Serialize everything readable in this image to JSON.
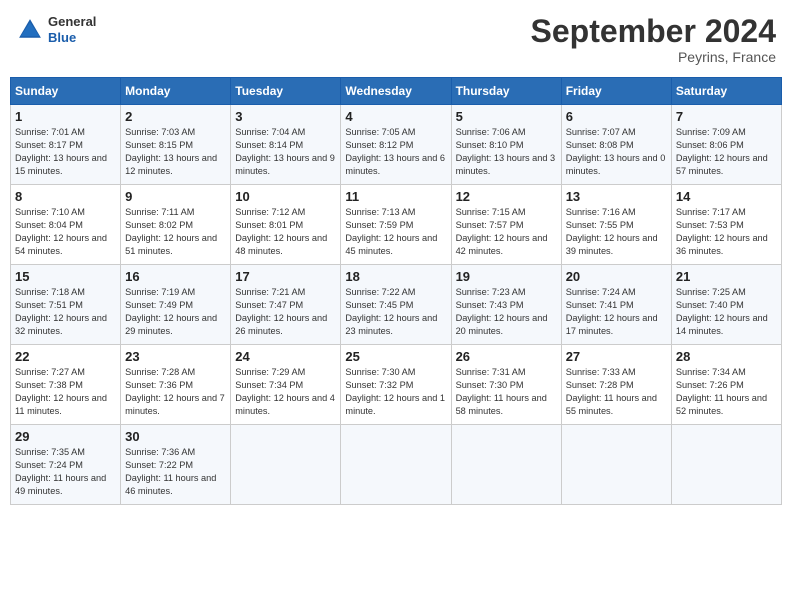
{
  "header": {
    "logo": {
      "line1": "General",
      "line2": "Blue"
    },
    "title": "September 2024",
    "subtitle": "Peyrins, France"
  },
  "days_of_week": [
    "Sunday",
    "Monday",
    "Tuesday",
    "Wednesday",
    "Thursday",
    "Friday",
    "Saturday"
  ],
  "weeks": [
    [
      {
        "day": 1,
        "sunrise": "Sunrise: 7:01 AM",
        "sunset": "Sunset: 8:17 PM",
        "daylight": "Daylight: 13 hours and 15 minutes."
      },
      {
        "day": 2,
        "sunrise": "Sunrise: 7:03 AM",
        "sunset": "Sunset: 8:15 PM",
        "daylight": "Daylight: 13 hours and 12 minutes."
      },
      {
        "day": 3,
        "sunrise": "Sunrise: 7:04 AM",
        "sunset": "Sunset: 8:14 PM",
        "daylight": "Daylight: 13 hours and 9 minutes."
      },
      {
        "day": 4,
        "sunrise": "Sunrise: 7:05 AM",
        "sunset": "Sunset: 8:12 PM",
        "daylight": "Daylight: 13 hours and 6 minutes."
      },
      {
        "day": 5,
        "sunrise": "Sunrise: 7:06 AM",
        "sunset": "Sunset: 8:10 PM",
        "daylight": "Daylight: 13 hours and 3 minutes."
      },
      {
        "day": 6,
        "sunrise": "Sunrise: 7:07 AM",
        "sunset": "Sunset: 8:08 PM",
        "daylight": "Daylight: 13 hours and 0 minutes."
      },
      {
        "day": 7,
        "sunrise": "Sunrise: 7:09 AM",
        "sunset": "Sunset: 8:06 PM",
        "daylight": "Daylight: 12 hours and 57 minutes."
      }
    ],
    [
      {
        "day": 8,
        "sunrise": "Sunrise: 7:10 AM",
        "sunset": "Sunset: 8:04 PM",
        "daylight": "Daylight: 12 hours and 54 minutes."
      },
      {
        "day": 9,
        "sunrise": "Sunrise: 7:11 AM",
        "sunset": "Sunset: 8:02 PM",
        "daylight": "Daylight: 12 hours and 51 minutes."
      },
      {
        "day": 10,
        "sunrise": "Sunrise: 7:12 AM",
        "sunset": "Sunset: 8:01 PM",
        "daylight": "Daylight: 12 hours and 48 minutes."
      },
      {
        "day": 11,
        "sunrise": "Sunrise: 7:13 AM",
        "sunset": "Sunset: 7:59 PM",
        "daylight": "Daylight: 12 hours and 45 minutes."
      },
      {
        "day": 12,
        "sunrise": "Sunrise: 7:15 AM",
        "sunset": "Sunset: 7:57 PM",
        "daylight": "Daylight: 12 hours and 42 minutes."
      },
      {
        "day": 13,
        "sunrise": "Sunrise: 7:16 AM",
        "sunset": "Sunset: 7:55 PM",
        "daylight": "Daylight: 12 hours and 39 minutes."
      },
      {
        "day": 14,
        "sunrise": "Sunrise: 7:17 AM",
        "sunset": "Sunset: 7:53 PM",
        "daylight": "Daylight: 12 hours and 36 minutes."
      }
    ],
    [
      {
        "day": 15,
        "sunrise": "Sunrise: 7:18 AM",
        "sunset": "Sunset: 7:51 PM",
        "daylight": "Daylight: 12 hours and 32 minutes."
      },
      {
        "day": 16,
        "sunrise": "Sunrise: 7:19 AM",
        "sunset": "Sunset: 7:49 PM",
        "daylight": "Daylight: 12 hours and 29 minutes."
      },
      {
        "day": 17,
        "sunrise": "Sunrise: 7:21 AM",
        "sunset": "Sunset: 7:47 PM",
        "daylight": "Daylight: 12 hours and 26 minutes."
      },
      {
        "day": 18,
        "sunrise": "Sunrise: 7:22 AM",
        "sunset": "Sunset: 7:45 PM",
        "daylight": "Daylight: 12 hours and 23 minutes."
      },
      {
        "day": 19,
        "sunrise": "Sunrise: 7:23 AM",
        "sunset": "Sunset: 7:43 PM",
        "daylight": "Daylight: 12 hours and 20 minutes."
      },
      {
        "day": 20,
        "sunrise": "Sunrise: 7:24 AM",
        "sunset": "Sunset: 7:41 PM",
        "daylight": "Daylight: 12 hours and 17 minutes."
      },
      {
        "day": 21,
        "sunrise": "Sunrise: 7:25 AM",
        "sunset": "Sunset: 7:40 PM",
        "daylight": "Daylight: 12 hours and 14 minutes."
      }
    ],
    [
      {
        "day": 22,
        "sunrise": "Sunrise: 7:27 AM",
        "sunset": "Sunset: 7:38 PM",
        "daylight": "Daylight: 12 hours and 11 minutes."
      },
      {
        "day": 23,
        "sunrise": "Sunrise: 7:28 AM",
        "sunset": "Sunset: 7:36 PM",
        "daylight": "Daylight: 12 hours and 7 minutes."
      },
      {
        "day": 24,
        "sunrise": "Sunrise: 7:29 AM",
        "sunset": "Sunset: 7:34 PM",
        "daylight": "Daylight: 12 hours and 4 minutes."
      },
      {
        "day": 25,
        "sunrise": "Sunrise: 7:30 AM",
        "sunset": "Sunset: 7:32 PM",
        "daylight": "Daylight: 12 hours and 1 minute."
      },
      {
        "day": 26,
        "sunrise": "Sunrise: 7:31 AM",
        "sunset": "Sunset: 7:30 PM",
        "daylight": "Daylight: 11 hours and 58 minutes."
      },
      {
        "day": 27,
        "sunrise": "Sunrise: 7:33 AM",
        "sunset": "Sunset: 7:28 PM",
        "daylight": "Daylight: 11 hours and 55 minutes."
      },
      {
        "day": 28,
        "sunrise": "Sunrise: 7:34 AM",
        "sunset": "Sunset: 7:26 PM",
        "daylight": "Daylight: 11 hours and 52 minutes."
      }
    ],
    [
      {
        "day": 29,
        "sunrise": "Sunrise: 7:35 AM",
        "sunset": "Sunset: 7:24 PM",
        "daylight": "Daylight: 11 hours and 49 minutes."
      },
      {
        "day": 30,
        "sunrise": "Sunrise: 7:36 AM",
        "sunset": "Sunset: 7:22 PM",
        "daylight": "Daylight: 11 hours and 46 minutes."
      },
      null,
      null,
      null,
      null,
      null
    ]
  ]
}
